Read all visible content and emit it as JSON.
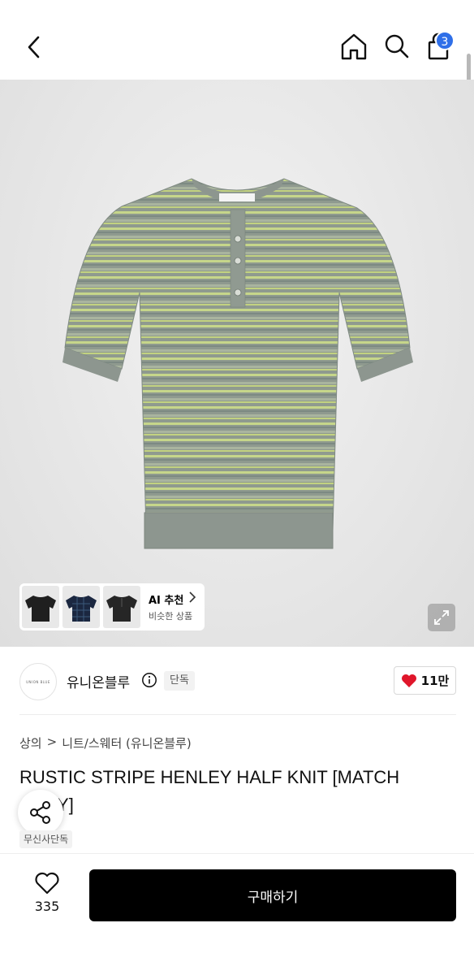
{
  "header": {
    "cart_count": "3"
  },
  "gallery": {
    "ai": {
      "title": "AI 추천",
      "subtitle": "비슷한 상품"
    },
    "thumbnails": [
      "black-tee-thumbnail",
      "navy-check-tee-thumbnail",
      "black-henley-thumbnail"
    ]
  },
  "brand": {
    "logo_text": "UNION BLUE",
    "name": "유니온블루",
    "exclusive_badge": "단독",
    "like_count": "11만"
  },
  "breadcrumb": {
    "category": "상의",
    "separator": ">",
    "subcategory": "니트/스웨터 (유니온블루)"
  },
  "product": {
    "title": "RUSTIC STRIPE HENLEY HALF KNIT [MATCH GRAY]",
    "badge": "무신사단독"
  },
  "bottom_bar": {
    "wish_count": "335",
    "buy_label": "구매하기"
  },
  "colors": {
    "accent": "#2f6fe8",
    "heart": "#e0162b",
    "knit_gray": "#8e9a8f",
    "stripe_lime": "#c9d98a"
  }
}
